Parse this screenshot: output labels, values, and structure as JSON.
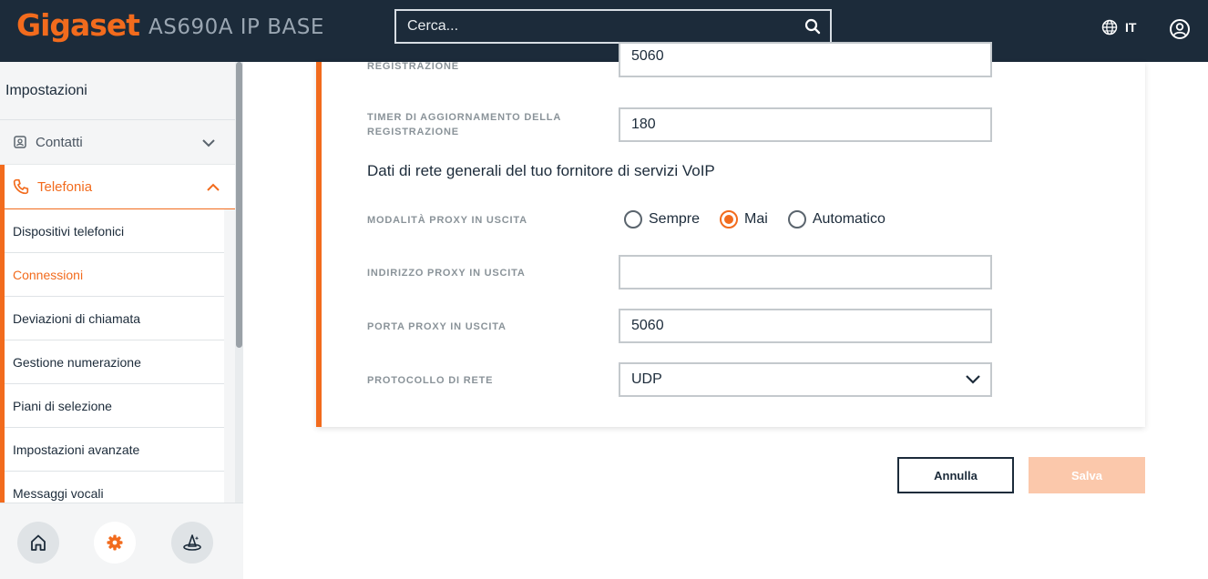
{
  "header": {
    "logo": "Gigaset",
    "model": "AS690A IP BASE",
    "search_placeholder": "Cerca...",
    "language": "IT"
  },
  "sidebar": {
    "title": "Impostazioni",
    "groups": [
      {
        "label": "Contatti",
        "expanded": false
      },
      {
        "label": "Telefonia",
        "expanded": true
      }
    ],
    "items": [
      {
        "label": "Dispositivi telefonici",
        "active": false
      },
      {
        "label": "Connessioni",
        "active": true
      },
      {
        "label": "Deviazioni di chiamata",
        "active": false
      },
      {
        "label": "Gestione numerazione",
        "active": false
      },
      {
        "label": "Piani di selezione",
        "active": false
      },
      {
        "label": "Impostazioni avanzate",
        "active": false
      },
      {
        "label": "Messaggi vocali",
        "active": false
      }
    ]
  },
  "form": {
    "reg_label_partial": "REGISTRAZIONE",
    "reg_value_partial": "5060",
    "timer_label": "TIMER DI AGGIORNAMENTO DELLA REGISTRAZIONE",
    "timer_value": "180",
    "section_title": "Dati di rete generali del tuo fornitore di servizi VoIP",
    "proxy_mode_label": "MODALITÀ PROXY IN USCITA",
    "proxy_mode_options": [
      "Sempre",
      "Mai",
      "Automatico"
    ],
    "proxy_mode_selected": "Mai",
    "proxy_address_label": "INDIRIZZO PROXY IN USCITA",
    "proxy_address_value": "",
    "proxy_port_label": "PORTA PROXY IN USCITA",
    "proxy_port_value": "5060",
    "protocol_label": "PROTOCOLLO DI RETE",
    "protocol_value": "UDP"
  },
  "actions": {
    "cancel": "Annulla",
    "save": "Salva"
  },
  "colors": {
    "accent": "#f26b1d",
    "header_bg": "#1c2b3a",
    "save_disabled": "#fbc8ab"
  }
}
